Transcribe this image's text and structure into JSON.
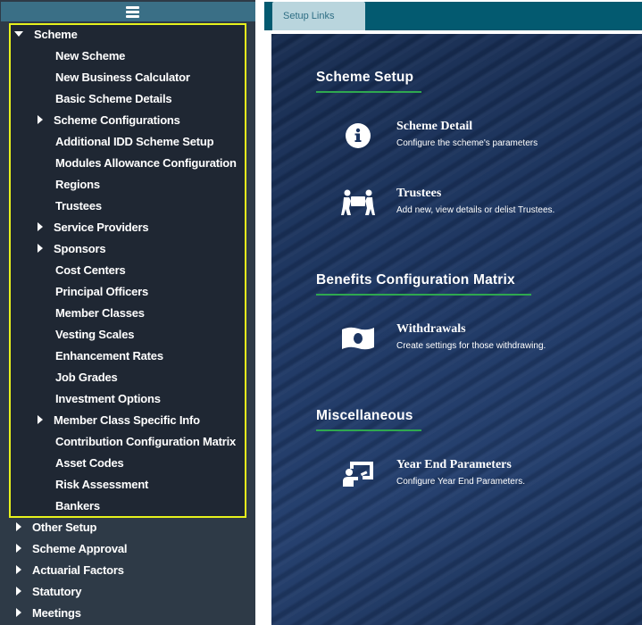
{
  "sidebar": {
    "menu_toggle_icon": "hamburger-icon",
    "scheme": {
      "label": "Scheme",
      "children": [
        {
          "label": "New Scheme",
          "expandable": false
        },
        {
          "label": "New Business Calculator",
          "expandable": false
        },
        {
          "label": "Basic Scheme Details",
          "expandable": false
        },
        {
          "label": "Scheme Configurations",
          "expandable": true
        },
        {
          "label": "Additional IDD Scheme Setup",
          "expandable": false
        },
        {
          "label": "Modules Allowance Configuration",
          "expandable": false
        },
        {
          "label": "Regions",
          "expandable": false
        },
        {
          "label": "Trustees",
          "expandable": false
        },
        {
          "label": "Service Providers",
          "expandable": true
        },
        {
          "label": "Sponsors",
          "expandable": true
        },
        {
          "label": "Cost Centers",
          "expandable": false
        },
        {
          "label": "Principal Officers",
          "expandable": false
        },
        {
          "label": "Member Classes",
          "expandable": false
        },
        {
          "label": "Vesting Scales",
          "expandable": false
        },
        {
          "label": "Enhancement Rates",
          "expandable": false
        },
        {
          "label": "Job Grades",
          "expandable": false
        },
        {
          "label": "Investment Options",
          "expandable": false
        },
        {
          "label": "Member Class Specific Info",
          "expandable": true
        },
        {
          "label": "Contribution Configuration Matrix",
          "expandable": false
        },
        {
          "label": "Asset Codes",
          "expandable": false
        },
        {
          "label": "Risk Assessment",
          "expandable": false
        },
        {
          "label": "Bankers",
          "expandable": false
        }
      ]
    },
    "other_sections": [
      {
        "label": "Other Setup"
      },
      {
        "label": "Scheme Approval"
      },
      {
        "label": "Actuarial Factors"
      },
      {
        "label": "Statutory"
      },
      {
        "label": "Meetings"
      }
    ]
  },
  "tabs": [
    {
      "label": "Setup Links"
    }
  ],
  "sections": [
    {
      "title": "Scheme Setup",
      "items": [
        {
          "title": "Scheme Detail",
          "description": "Configure the scheme's parameters",
          "icon": "info-circle-icon"
        },
        {
          "title": "Trustees",
          "description": "Add new, view details or delist Trustees.",
          "icon": "people-carry-icon"
        }
      ]
    },
    {
      "title": "Benefits Configuration Matrix",
      "items": [
        {
          "title": "Withdrawals",
          "description": "Create settings for those withdrawing.",
          "icon": "money-bill-wave-icon"
        }
      ]
    },
    {
      "title": "Miscellaneous",
      "items": [
        {
          "title": "Year End Parameters",
          "description": "Configure Year End Parameters.",
          "icon": "chalkboard-teacher-icon"
        }
      ]
    }
  ],
  "colors": {
    "sidebar_bg": "#2e3a47",
    "selected_group_bg": "#1f2733",
    "highlight_border": "#e7f21c",
    "tabbar_bg": "#035a70",
    "tab_bg": "#b9d5dd",
    "section_underline": "#2fa84f"
  }
}
